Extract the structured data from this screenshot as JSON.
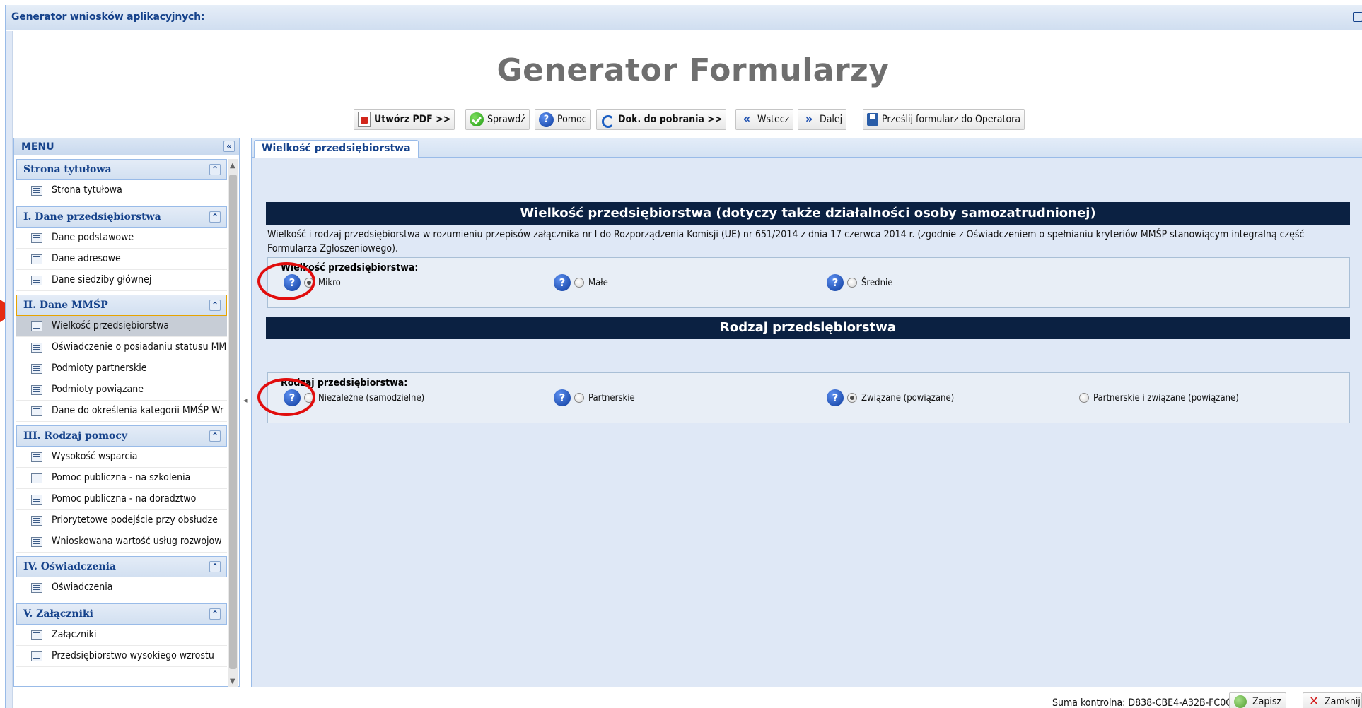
{
  "window": {
    "title": "Generator wniosków aplikacyjnych:"
  },
  "header": {
    "title": "Generator Formularzy"
  },
  "toolbar": {
    "create_pdf": "Utwórz PDF >>",
    "check": "Sprawdź",
    "help": "Pomoc",
    "download_docs": "Dok. do pobrania >>",
    "back": "Wstecz",
    "next": "Dalej",
    "send_form": "Prześlij formularz do Operatora"
  },
  "sidebar": {
    "title": "MENU",
    "collapse_glyph": "«",
    "group_glyph": "⌃",
    "groups": [
      {
        "label": "Strona tytułowa",
        "items": [
          "Strona tytułowa"
        ]
      },
      {
        "label": "I. Dane przedsiębiorstwa",
        "items": [
          "Dane podstawowe",
          "Dane adresowe",
          "Dane siedziby głównej"
        ]
      },
      {
        "label": "II. Dane MMŚP",
        "items": [
          "Wielkość przedsiębiorstwa",
          "Oświadczenie o posiadaniu statusu MM",
          "Podmioty partnerskie",
          "Podmioty powiązane",
          "Dane do określenia kategorii MMŚP Wr"
        ]
      },
      {
        "label": "III. Rodzaj pomocy",
        "items": [
          "Wysokość wsparcia",
          "Pomoc publiczna - na szkolenia",
          "Pomoc publiczna - na doradztwo",
          "Priorytetowe podejście przy obsłudze",
          "Wnioskowana wartość usług rozwojow"
        ]
      },
      {
        "label": "IV. Oświadczenia",
        "items": [
          "Oświadczenia"
        ]
      },
      {
        "label": "V. Załączniki",
        "items": [
          "Załączniki",
          "Przedsiębiorstwo wysokiego wzrostu"
        ]
      }
    ],
    "selected_item": "Wielkość przedsiębiorstwa"
  },
  "main": {
    "tab": "Wielkość przedsiębiorstwa",
    "section1": {
      "header": "Wielkość przedsiębiorstwa (dotyczy także działalności osoby samozatrudnionej)",
      "description": "Wielkość i rodzaj przedsiębiorstwa w rozumieniu przepisów załącznika nr I do Rozporządzenia Komisji (UE) nr 651/2014 z dnia 17 czerwca 2014 r. (zgodnie z Oświadczeniem o spełnianiu kryteriów MMŚP stanowiącym integralną część Formularza Zgłoszeniowego).",
      "legend": "Wielkość przedsiębiorstwa:",
      "options": [
        "Mikro",
        "Małe",
        "Średnie"
      ],
      "selected": "Mikro"
    },
    "section2": {
      "header": "Rodzaj przedsiębiorstwa",
      "legend": "Rodzaj przedsiębiorstwa:",
      "options": [
        "Niezależne (samodzielne)",
        "Partnerskie",
        "Związane (powiązane)",
        "Partnerskie i związane (powiązane)"
      ],
      "selected": "Związane (powiązane)"
    }
  },
  "statusbar": {
    "checksum": "Suma kontrolna: D838-CBE4-A32B-FC0C",
    "save": "Zapisz",
    "close": "Zamknij"
  },
  "colors": {
    "section_header_bg": "#0b2142",
    "accent_blue": "#15428b",
    "annotation_red": "#e10d0d"
  }
}
